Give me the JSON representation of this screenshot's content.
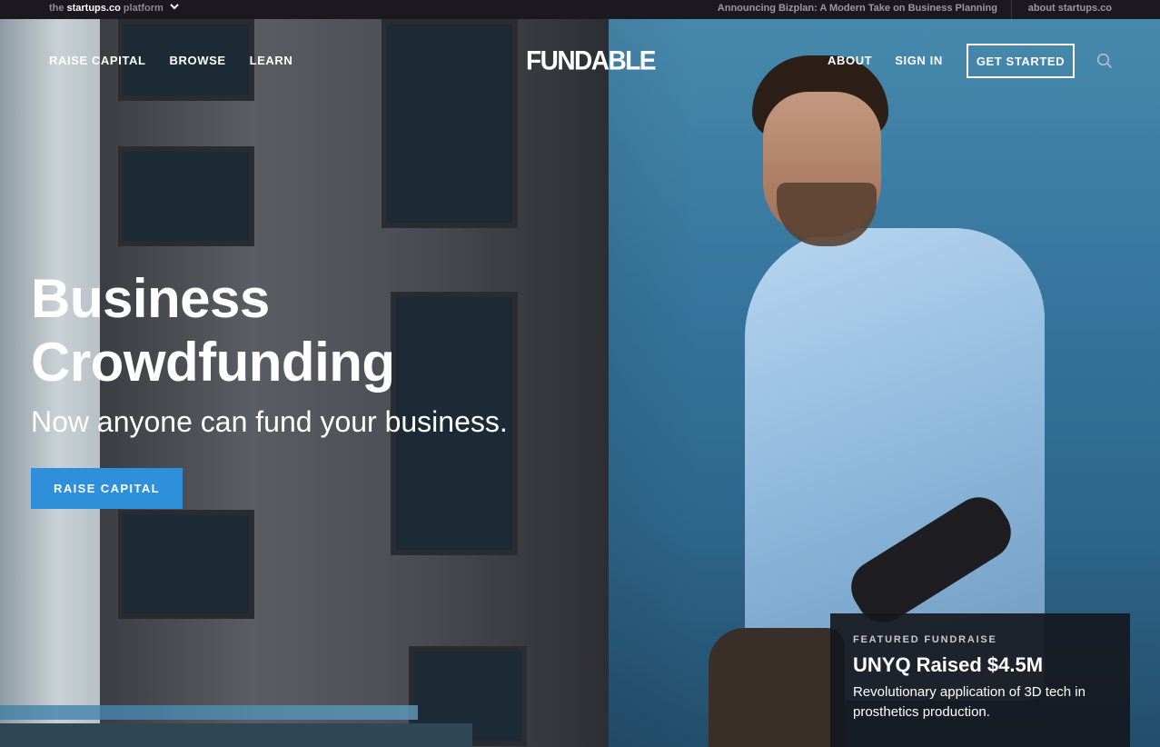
{
  "topbar": {
    "platform_prefix": "the",
    "platform_brand": "startups.co",
    "platform_suffix": "platform",
    "announcement": "Announcing Bizplan: A Modern Take on Business Planning",
    "about_link": "about startups.co"
  },
  "header": {
    "logo": "FUNDABLE",
    "nav_left": [
      "RAISE CAPITAL",
      "BROWSE",
      "LEARN"
    ],
    "nav_right": [
      "ABOUT",
      "SIGN IN"
    ],
    "cta": "GET STARTED",
    "icons": {
      "search": "search-icon",
      "platform_dropdown": "chevron-down-icon"
    }
  },
  "hero": {
    "title_line1": "Business",
    "title_line2": "Crowdfunding",
    "subtitle": "Now anyone can fund your business.",
    "cta": "RAISE CAPITAL",
    "cta_color": "#2e90db"
  },
  "featured": {
    "eyebrow": "FEATURED FUNDRAISE",
    "title": "UNYQ Raised $4.5M",
    "description": "Revolutionary application of 3D tech in prosthetics production."
  }
}
